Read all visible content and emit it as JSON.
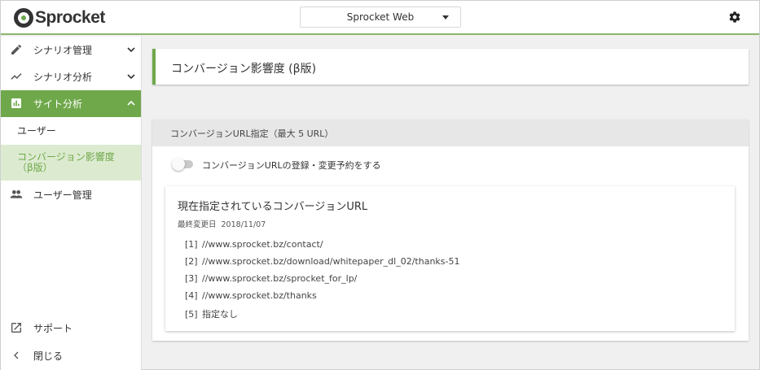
{
  "header": {
    "logo_text": "Sprocket",
    "project_select": "Sprocket Web",
    "settings_icon": "gear-icon"
  },
  "sidebar": {
    "items": [
      {
        "label": "シナリオ管理",
        "icon": "pencil-icon",
        "chevron": "chevron-down-icon"
      },
      {
        "label": "シナリオ分析",
        "icon": "trending-up-icon",
        "chevron": "chevron-down-icon"
      },
      {
        "label": "サイト分析",
        "icon": "bar-chart-icon",
        "chevron": "chevron-up-icon",
        "active": true
      },
      {
        "label": "ユーザー管理",
        "icon": "people-icon"
      }
    ],
    "sub_items": [
      {
        "label": "ユーザー"
      },
      {
        "label": "コンバージョン影響度 （β版）",
        "selected": true
      }
    ],
    "footer": [
      {
        "label": "サポート",
        "icon": "external-link-icon"
      },
      {
        "label": "閉じる",
        "icon": "chevron-left-icon"
      }
    ]
  },
  "main": {
    "page_title": "コンバージョン影響度 (β版)",
    "panel": {
      "heading": "コンバージョンURL指定（最大 5 URL）",
      "toggle_label": "コンバージョンURLの登録・変更予約をする",
      "toggle_on": false,
      "card": {
        "title": "現在指定されているコンバージョンURL",
        "updated_label": "最終変更日",
        "updated_date": "2018/11/07",
        "urls": [
          {
            "index": "[1]",
            "url": "//www.sprocket.bz/contact/"
          },
          {
            "index": "[2]",
            "url": "//www.sprocket.bz/download/whitepaper_dl_02/thanks-51"
          },
          {
            "index": "[3]",
            "url": "//www.sprocket.bz/sprocket_for_lp/"
          },
          {
            "index": "[4]",
            "url": "//www.sprocket.bz/thanks"
          },
          {
            "index": "[5]",
            "url": "指定なし"
          }
        ]
      }
    }
  },
  "colors": {
    "accent": "#6fa84a",
    "accent_light": "#dcebd0",
    "header_border": "#8bb56b"
  }
}
